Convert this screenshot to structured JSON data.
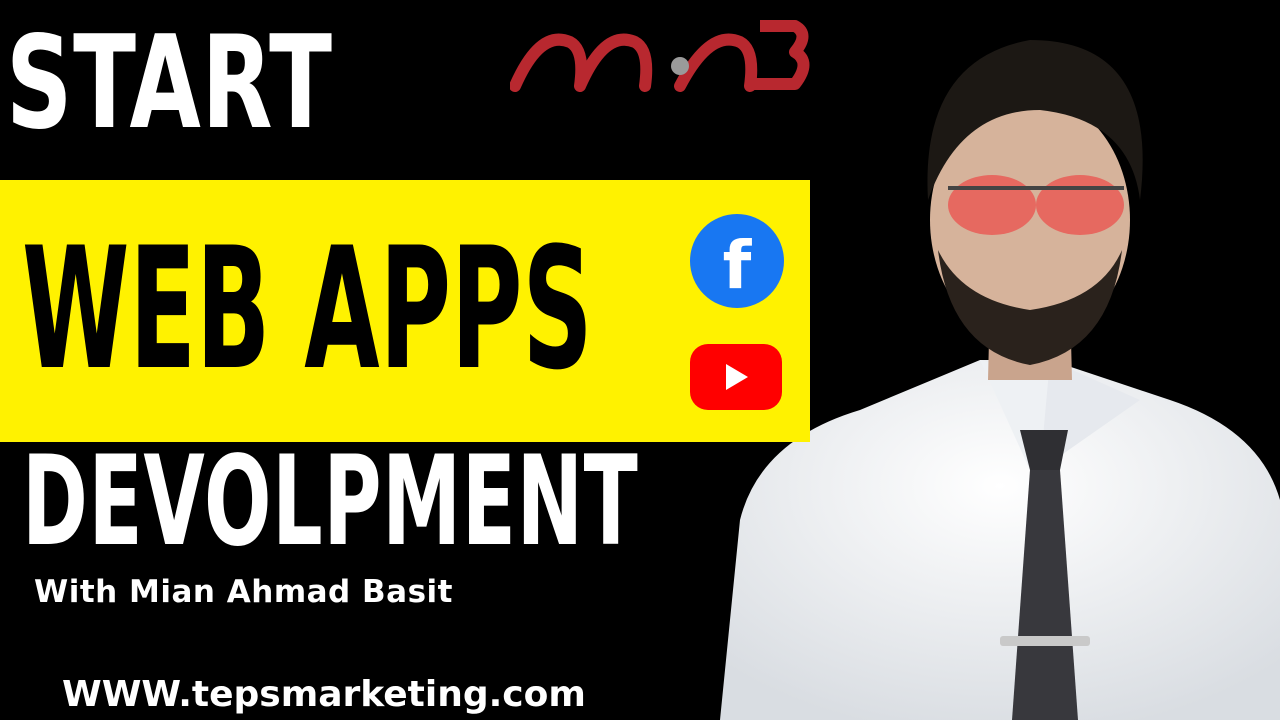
{
  "thumbnail": {
    "line1": "START",
    "line2": "WEB APPS",
    "line3": "DEVOLPMENT",
    "subtitle": "With Mian Ahmad Basit",
    "website": "WWW.tepsmarketing.com"
  },
  "logo": {
    "text": "MAB",
    "color": "#B8282F"
  },
  "social_icons": [
    "facebook-icon",
    "youtube-icon"
  ],
  "colors": {
    "background": "#000000",
    "band": "#FFF200",
    "facebook": "#1877F2",
    "youtube": "#FF0000"
  }
}
